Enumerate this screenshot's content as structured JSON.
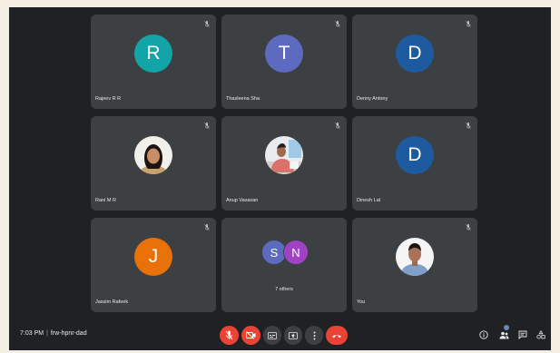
{
  "participants": [
    {
      "name": "Rajeev R R",
      "initial": "R",
      "color": "#12a4a6"
    },
    {
      "name": "Thasleena Sha",
      "initial": "T",
      "color": "#5c6bc0"
    },
    {
      "name": "Denny Antony",
      "initial": "D",
      "color": "#1e5aa0"
    },
    {
      "name": "Rani M R",
      "initial": ""
    },
    {
      "name": "Anup Vasavan",
      "initial": ""
    },
    {
      "name": "Dinesh Lal",
      "initial": "D",
      "color": "#1e5aa0"
    },
    {
      "name": "Jassim Rafeek",
      "initial": "J",
      "color": "#e8710a"
    },
    {
      "name": "You",
      "initial": ""
    }
  ],
  "others_tile": {
    "label": "7 others",
    "avatars": [
      {
        "initial": "S",
        "color": "#5c6bc0"
      },
      {
        "initial": "N",
        "color": "#a142c4"
      }
    ]
  },
  "meeting": {
    "time": "7:03 PM",
    "separator": "|",
    "code": "frw-hpnr-dad"
  },
  "icons": {
    "tile_mic": "mic-off-icon",
    "mic_button": "mic-off-icon",
    "camera_button": "camera-off-icon",
    "captions_button": "captions-icon",
    "present_button": "present-screen-icon",
    "more_button": "more-vert-icon",
    "end_call_button": "call-end-icon",
    "info_button": "info-icon",
    "people_button": "people-icon",
    "chat_button": "chat-icon",
    "activities_button": "activities-icon"
  },
  "colors": {
    "background": "#202124",
    "tile": "#3c4043",
    "danger": "#ea4335",
    "control": "#3c4043"
  }
}
